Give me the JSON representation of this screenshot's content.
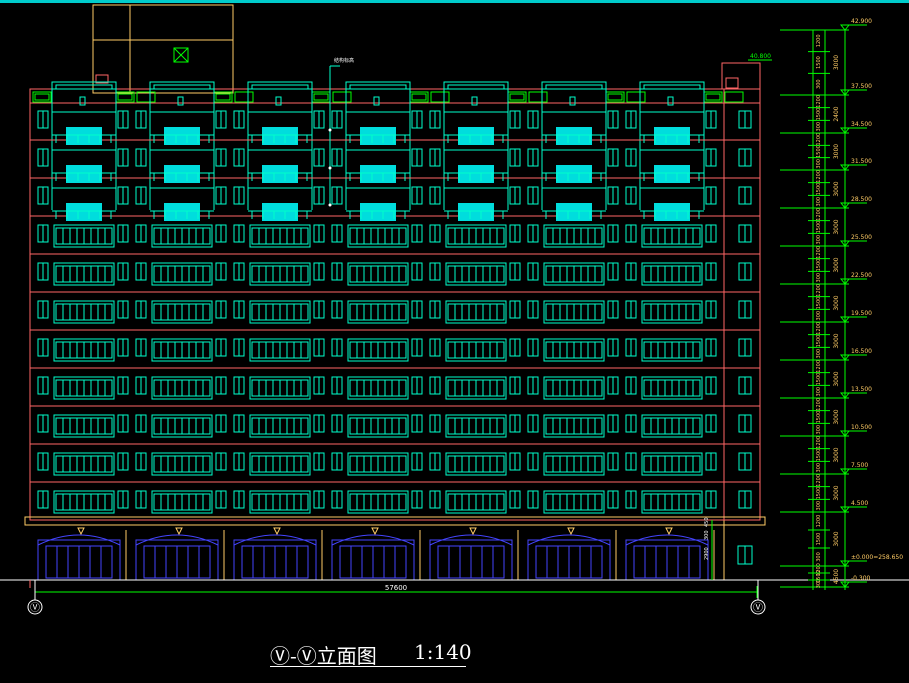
{
  "drawing": {
    "title": "Ⓥ-Ⓥ立面图",
    "scale": "1:140",
    "total_width_dim": "57600",
    "axis_label": "Ⓥ",
    "roof_level": "40.800",
    "parapet_note": "结构标高"
  },
  "elevations": [
    "42.900",
    "37.500",
    "34.500",
    "31.500",
    "28.500",
    "25.500",
    "22.500",
    "19.500",
    "16.500",
    "13.500",
    "10.500",
    "7.500",
    "4.500",
    "±0.000=258.650",
    "-0.300"
  ],
  "side_dims": [
    "3000",
    "2400",
    "3000",
    "3000",
    "3000",
    "3000",
    "3000",
    "3000",
    "3000",
    "3000",
    "3000",
    "3000",
    "3000",
    "4500",
    "300"
  ],
  "sub_dims": [
    "1200",
    "1500",
    "300"
  ],
  "base_dims": [
    "2900",
    "300",
    "450"
  ],
  "colors": {
    "background": "#000000",
    "outline": "#ff6666",
    "window": "#00ffcc",
    "glass": "#00dddd",
    "dimension": "#00ff00",
    "shop_front": "#4444ff",
    "text": "#ffffff",
    "accent_yellow": "#ffcc66"
  }
}
